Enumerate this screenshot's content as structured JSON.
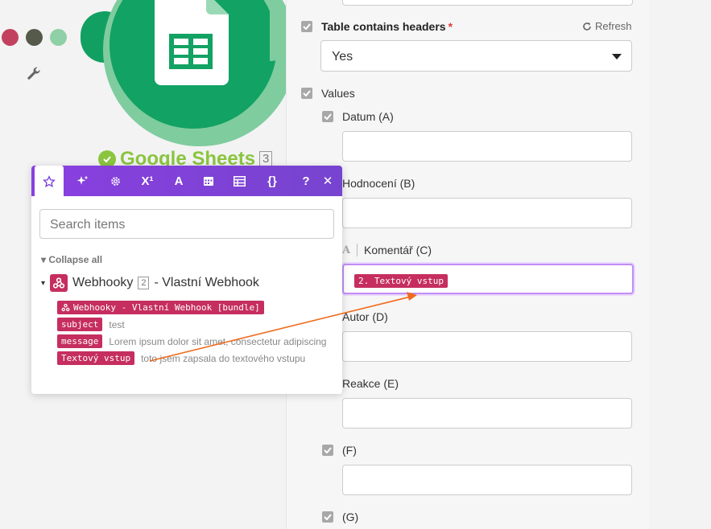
{
  "colors": {
    "accent_purple": "#7a3fd8",
    "google_green": "#12a263",
    "pill_red": "#c52e5f",
    "arrow_orange": "#f06a1c"
  },
  "canvas": {
    "dots": [
      "#c2415f",
      "#555a4b",
      "#8fd0a6"
    ],
    "wrench_icon": "wrench-icon",
    "module": {
      "title": "Google Sheets",
      "number": "3",
      "icon": "google-sheets-icon"
    }
  },
  "panel": {
    "headers_label": "Table contains headers",
    "required_mark": "*",
    "refresh_label": "Refresh",
    "headers_value": "Yes",
    "values_label": "Values",
    "fields": [
      {
        "label": "Datum (A)",
        "value": ""
      },
      {
        "label": "Hodnocení (B)",
        "value": ""
      },
      {
        "label": "Komentář (C)",
        "value": "2. Textový vstup"
      },
      {
        "label": "Autor (D)",
        "value": ""
      },
      {
        "label": "Reakce (E)",
        "value": ""
      },
      {
        "label": "(F)",
        "value": ""
      },
      {
        "label": "(G)",
        "value": ""
      }
    ]
  },
  "popup": {
    "tabs": [
      "star-icon",
      "sparkles-icon",
      "gear-icon",
      "superscript-icon",
      "text-icon",
      "calendar-icon",
      "table-icon",
      "braces-icon"
    ],
    "help": "?",
    "close": "✕",
    "search_placeholder": "Search items",
    "collapse_all": "Collapse all",
    "webhook": {
      "name": "Webhooky",
      "number": "2",
      "suffix": "- Vlastní Webhook"
    },
    "bundle_label": "Webhooky - Vlastní Webhook [bundle]",
    "items": [
      {
        "key": "subject",
        "value": "test"
      },
      {
        "key": "message",
        "value": "Lorem ipsum dolor sit amet, consectetur adipiscing"
      },
      {
        "key": "Textový vstup",
        "value": "toto jsem zapsala do textového vstupu"
      }
    ]
  }
}
